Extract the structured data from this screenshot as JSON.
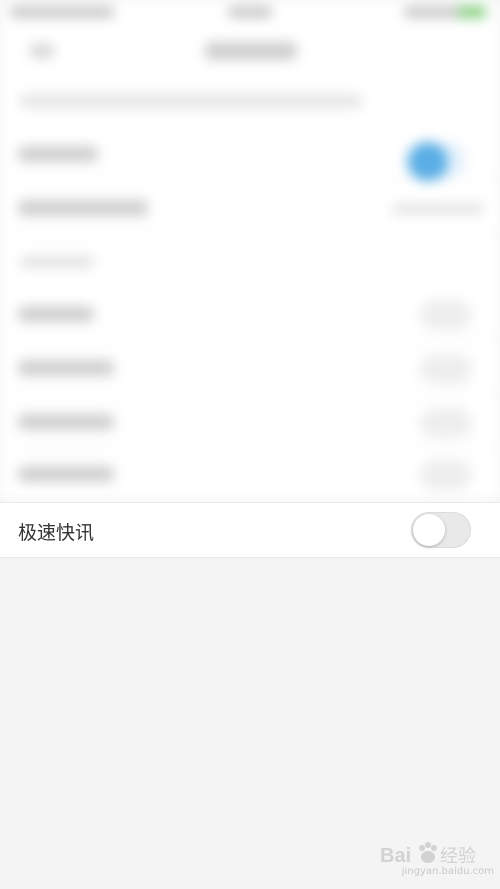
{
  "settings": {
    "fast_news_label": "极速快讯",
    "fast_news_enabled": false
  },
  "colors": {
    "toggle_off": "#e9e9e9",
    "accent_blue": "#5aaee5",
    "battery_green": "#86d07f",
    "background": "#f4f4f4"
  },
  "watermark": {
    "brand": "Baidu经验",
    "url": "jingyan.baidu.com"
  }
}
